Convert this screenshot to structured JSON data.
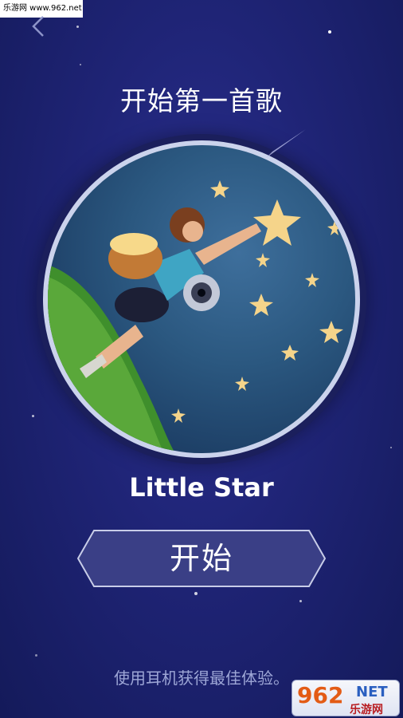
{
  "watermark": {
    "top_left_text": "乐游网 www.962.net"
  },
  "header": {
    "title": "开始第一首歌"
  },
  "player": {
    "song_title": "Little Star"
  },
  "actions": {
    "start_label": "开始"
  },
  "footer": {
    "tip": "使用耳机获得最佳体验。"
  },
  "logo": {
    "number": "962",
    "suffix": "NET",
    "name": "乐游网"
  },
  "colors": {
    "background": "#1f2476",
    "button_fill": "#3a3f86",
    "button_border": "#c8cde8",
    "tip_text": "#9da6d6"
  },
  "icons": {
    "back": "chevron-left-icon"
  }
}
